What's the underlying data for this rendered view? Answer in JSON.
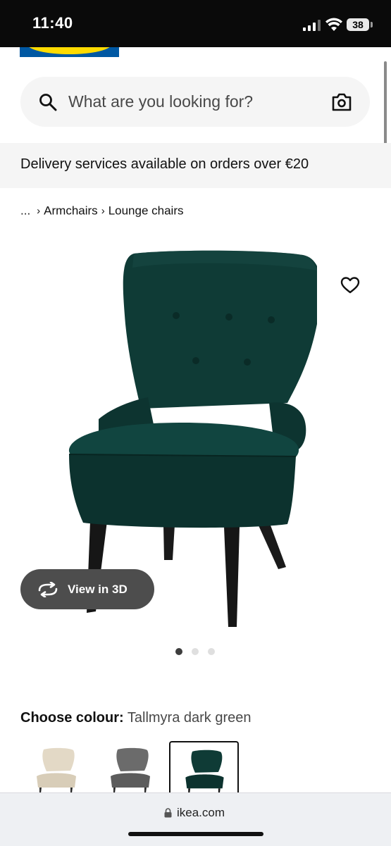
{
  "status_bar": {
    "time": "11:40",
    "battery": "38"
  },
  "search": {
    "placeholder": "What are you looking for?"
  },
  "delivery_banner": {
    "text": "Delivery services available on orders over €20"
  },
  "breadcrumb": {
    "ellipsis": "...",
    "items": [
      "Armchairs",
      "Lounge chairs"
    ]
  },
  "product": {
    "view_3d_label": "View in 3D",
    "carousel": {
      "count": 3,
      "active_index": 0
    }
  },
  "colour": {
    "heading_label": "Choose colour:",
    "selected_value": "Tallmyra dark green",
    "swatches": [
      "beige",
      "grey",
      "dark-green"
    ],
    "selected_index": 2
  },
  "browser": {
    "url": "ikea.com"
  },
  "colors": {
    "brand_blue": "#0058a3",
    "brand_yellow": "#ffdb00",
    "chair_green": "#0f3b36"
  }
}
